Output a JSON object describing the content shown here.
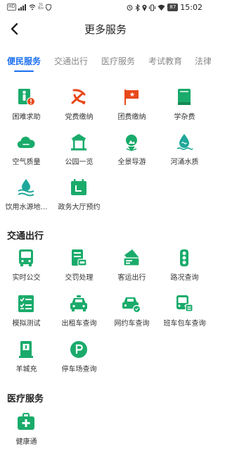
{
  "status_bar": {
    "network_badge": "HD",
    "speed_value": "31",
    "speed_unit": "B/s",
    "battery": "87",
    "time": "15:02"
  },
  "header": {
    "title": "更多服务"
  },
  "tabs": [
    {
      "label": "便民服务",
      "active": true
    },
    {
      "label": "交通出行",
      "active": false
    },
    {
      "label": "医疗服务",
      "active": false
    },
    {
      "label": "考试教育",
      "active": false
    },
    {
      "label": "法律",
      "active": false
    }
  ],
  "sections": {
    "transport": {
      "title": "交通出行"
    },
    "medical": {
      "title": "医疗服务"
    }
  },
  "services": {
    "civil": [
      {
        "label": "困难求助",
        "icon": "help-person-icon"
      },
      {
        "label": "党费缴纳",
        "icon": "party-emblem-icon"
      },
      {
        "label": "团费缴纳",
        "icon": "league-flag-icon"
      },
      {
        "label": "学杂费",
        "icon": "book-icon"
      },
      {
        "label": "空气质量",
        "icon": "cloud-icon"
      },
      {
        "label": "公园一览",
        "icon": "pavilion-icon"
      },
      {
        "label": "全景导游",
        "icon": "panorama-icon"
      },
      {
        "label": "河涌水质",
        "icon": "water-drop-icon"
      },
      {
        "label": "饮用水源地…",
        "icon": "water-source-icon"
      },
      {
        "label": "政务大厅预约",
        "icon": "calendar-icon"
      }
    ],
    "transport": [
      {
        "label": "实时公交",
        "icon": "bus-icon"
      },
      {
        "label": "交罚处理",
        "icon": "fine-ticket-icon"
      },
      {
        "label": "客运出行",
        "icon": "ticket-icon"
      },
      {
        "label": "路况查询",
        "icon": "traffic-light-icon"
      },
      {
        "label": "模拟测试",
        "icon": "checklist-icon"
      },
      {
        "label": "出租车查询",
        "icon": "taxi-icon"
      },
      {
        "label": "网约车查询",
        "icon": "ride-hailing-icon"
      },
      {
        "label": "班车包车查询",
        "icon": "shuttle-bus-icon"
      },
      {
        "label": "羊城充",
        "icon": "charging-station-icon"
      },
      {
        "label": "停车场查询",
        "icon": "parking-icon"
      }
    ],
    "medical": [
      {
        "label": "健康通",
        "icon": "medical-kit-icon"
      }
    ]
  },
  "colors": {
    "accent_blue": "#1a6ff0",
    "green": "#1aab6b",
    "red": "#e8491b",
    "water_teal": "#1fa89a"
  }
}
